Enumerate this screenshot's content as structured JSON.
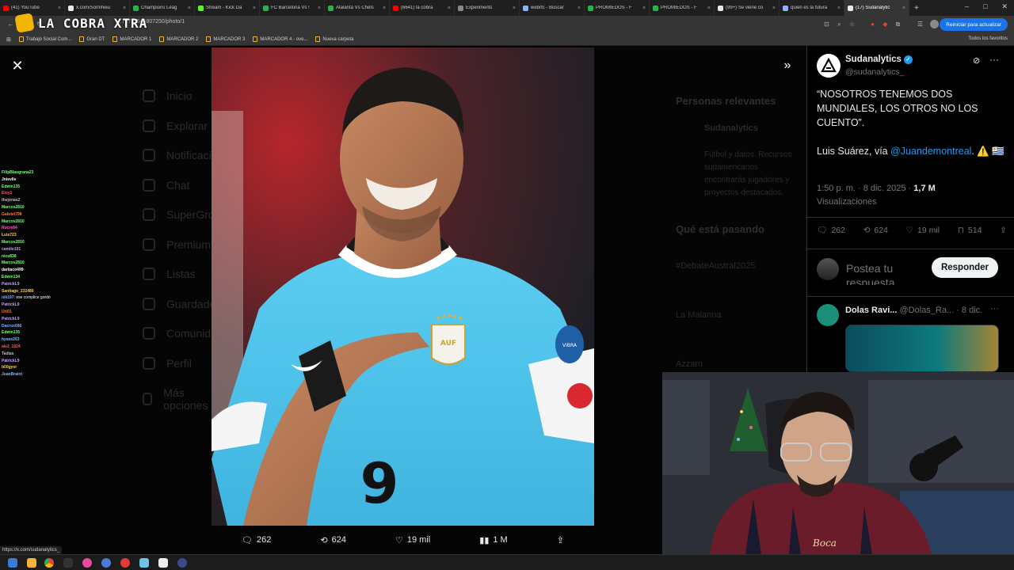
{
  "browser": {
    "tabs": [
      {
        "label": "(41) YouTube",
        "color": "#ff0000"
      },
      {
        "label": "x.com/Sornihieu",
        "color": "#e7e9ea"
      },
      {
        "label": "Champions Leag",
        "color": "#29b34a"
      },
      {
        "label": "Stream - Kick Da",
        "color": "#53fc18"
      },
      {
        "label": "FC Barcelona Vs !",
        "color": "#29b34a"
      },
      {
        "label": "Atalanta Vs Chels",
        "color": "#29b34a"
      },
      {
        "label": "(6641) la cobra",
        "color": "#ff0000"
      },
      {
        "label": "Experiments",
        "color": "#888888"
      },
      {
        "label": "webrtc - Buscar",
        "color": "#8ab4f8"
      },
      {
        "label": "PROMIEDOS - F",
        "color": "#29b34a"
      },
      {
        "label": "PROMIEDOS - F",
        "color": "#29b34a"
      },
      {
        "label": "(99+) Se viene co",
        "color": "#e7e9ea"
      },
      {
        "label": "quien es la futura",
        "color": "#8ab4f8"
      },
      {
        "label": "(17) Sudanalytic",
        "color": "#e7e9ea",
        "active": true
      }
    ],
    "new_tab": "+",
    "url": "...72711545807250/photo/1",
    "update_button": "Reiniciar para actualizar",
    "bookmarks": [
      "Trabajo Social Com...",
      "Gran DT",
      "MARCADOR 1",
      "MARCADOR 2",
      "MARCADOR 3",
      "MARCADOR 4 - ove...",
      "Nueva carpeta"
    ],
    "all_bookmarks": "Todos los favoritos",
    "status_url": "https://x.com/sudanalytics_"
  },
  "overlay": {
    "logo_text": "LA COBRA XTRA"
  },
  "chat": [
    {
      "user": "FilipBlaugrana23",
      "color": "#7cff7c",
      "msg": ""
    },
    {
      "user": "Jnievlle",
      "color": "#ffffff",
      "msg": ""
    },
    {
      "user": "Edwin135",
      "color": "#7cff7c",
      "msg": ""
    },
    {
      "user": "Eloy1",
      "color": "#ff5a5a",
      "msg": ""
    },
    {
      "user": "thejonas2",
      "color": "#bfbfbf",
      "msg": ""
    },
    {
      "user": "Marcos2810",
      "color": "#7cff7c",
      "msg": ""
    },
    {
      "user": "Gabriel798",
      "color": "#ff7a3c",
      "msg": ""
    },
    {
      "user": "Marcos2810",
      "color": "#7cff7c",
      "msg": ""
    },
    {
      "user": "Rocre84",
      "color": "#ff5ac8",
      "msg": ""
    },
    {
      "user": "Luis723",
      "color": "#ffd24a",
      "msg": ""
    },
    {
      "user": "Marcos2810",
      "color": "#7cff7c",
      "msg": ""
    },
    {
      "user": "camilo101",
      "color": "#c4a0ff",
      "msg": ""
    },
    {
      "user": "nico838",
      "color": "#7cff7c",
      "msg": ""
    },
    {
      "user": "Marcos2810",
      "color": "#7cff7c",
      "msg": ""
    },
    {
      "user": "dariiaco499",
      "color": "#ffffff",
      "msg": ""
    },
    {
      "user": "Edwin134",
      "color": "#7cff7c",
      "msg": ""
    },
    {
      "user": "PatrickL9",
      "color": "#c4a0ff",
      "msg": ""
    },
    {
      "user": "Santiago_232480",
      "color": "#ffd24a",
      "msg": ""
    },
    {
      "user": "nik197",
      "color": "#7ab8ff",
      "msg": ": ese complice gordo"
    },
    {
      "user": "PatrickL9",
      "color": "#c4a0ff",
      "msg": ""
    },
    {
      "user": "Uri01",
      "color": "#ff7a3c",
      "msg": ""
    },
    {
      "user": "PatrickL9",
      "color": "#c4a0ff",
      "msg": ""
    },
    {
      "user": "Dacrux666",
      "color": "#7ab8ff",
      "msg": ""
    },
    {
      "user": "Edwin135",
      "color": "#7cff7c",
      "msg": ""
    },
    {
      "user": "hyaxe263",
      "color": "#7ab8ff",
      "msg": ""
    },
    {
      "user": "ale2_1924",
      "color": "#ff5a5a",
      "msg": ""
    },
    {
      "user": "Tadias",
      "color": "#bfbfbf",
      "msg": ""
    },
    {
      "user": "PatrickL9",
      "color": "#c4a0ff",
      "msg": ""
    },
    {
      "user": "b00gyer",
      "color": "#ffd24a",
      "msg": ""
    },
    {
      "user": "JuanBraint",
      "color": "#7ab8ff",
      "msg": ""
    }
  ],
  "x_background": {
    "nav": [
      "Inicio",
      "Explorar",
      "Notificaciones",
      "Chat",
      "SuperGrok",
      "Premium",
      "Listas",
      "Guardados",
      "Comunidades",
      "Perfil",
      "Más opciones"
    ],
    "right_title": "Personas relevantes",
    "right_name": "Sudanalytics",
    "right_bio": "Fútbol y datos. Recursos sudamericanos encontrarás jugadores y proyectos destacados.",
    "trending_title": "Qué está pasando",
    "trending_tag": "#DebateAustral2025",
    "trend_2": "La Malanna",
    "trend_3": "Azzam"
  },
  "photo_actions": {
    "replies": "262",
    "reposts": "624",
    "likes": "19 mil",
    "views": "1 M"
  },
  "tweet": {
    "author_name": "Sudanalytics",
    "author_handle": "@sudanalytics_",
    "text_line1": "“NOSOTROS TENEMOS DOS MUNDIALES, LOS OTROS NO LOS CUENTO”.",
    "text_line2_pre": "Luis Suárez, vía ",
    "mention": "@Juandemontreal",
    "text_line2_post": ". ⚠️ 🇺🇾",
    "time": "1:50 p. m. · 8 dic. 2025 · ",
    "views_count": "1,7 M",
    "views_label": "Visualizaciones",
    "replies": "262",
    "reposts": "624",
    "likes": "19 mil",
    "bookmarks": "514",
    "reply_placeholder": "Postea tu respuesta",
    "reply_button": "Responder"
  },
  "reply": {
    "name": "Dolas Ravi...",
    "handle": "@Dolas_Ra...",
    "date": "· 8 dic."
  },
  "photo": {
    "jersey_number": "9",
    "badge_text": "AUF",
    "sleeve_text": "VIBRA"
  },
  "webcam": {
    "shirt_text": "Boca"
  },
  "colors": {
    "x_blue": "#1d9bf0",
    "uruguay_sky": "#4fc3e8"
  }
}
